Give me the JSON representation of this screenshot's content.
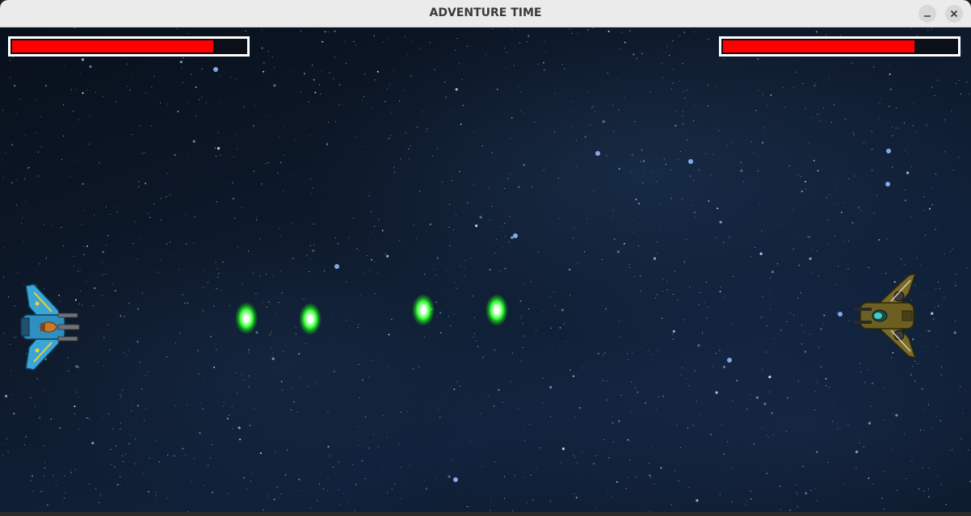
{
  "window": {
    "title": "ADVENTURE TIME",
    "minimize_icon": "minimize-icon",
    "close_icon": "close-icon"
  },
  "hud": {
    "player_health_fraction": 0.86,
    "enemy_health_fraction": 0.82,
    "health_color": "#ff0000"
  },
  "ships": {
    "player": "blue-starfighter-icon",
    "enemy": "olive-starfighter-icon"
  },
  "projectiles": {
    "color": "#33ff33",
    "count": 4
  }
}
